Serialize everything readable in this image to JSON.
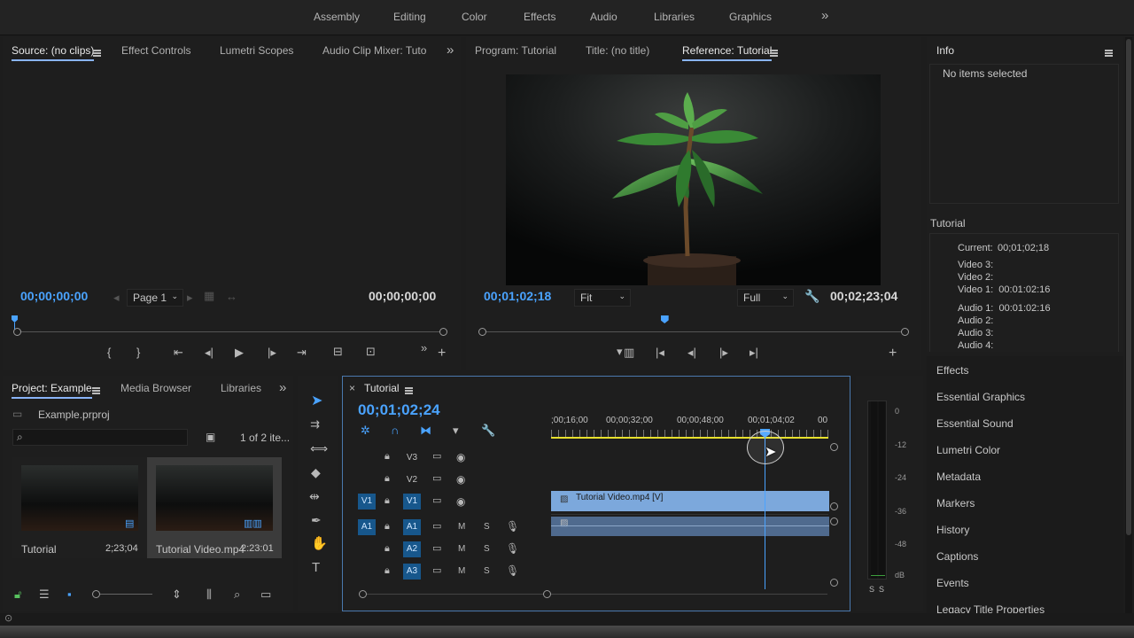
{
  "workspaces": [
    "Assembly",
    "Editing",
    "Color",
    "Effects",
    "Audio",
    "Libraries",
    "Graphics"
  ],
  "workspaces_more": "»",
  "source_panel": {
    "tabs": [
      "Source: (no clips)",
      "Effect Controls",
      "Lumetri Scopes",
      "Audio Clip Mixer: Tutoria"
    ],
    "timecode_in": "00;00;00;00",
    "timecode_out": "00;00;00;00",
    "page_select": "Page 1"
  },
  "program_panel": {
    "tabs": [
      "Program: Tutorial",
      "Title: (no title)",
      "Reference: Tutorial"
    ],
    "timecode": "00;01;02;18",
    "fit": "Fit",
    "quality": "Full",
    "duration": "00;02;23;04",
    "playhead_fraction": 0.43
  },
  "info_panel": {
    "title": "Info",
    "no_items": "No items selected",
    "sequence": "Tutorial",
    "current_label": "Current:",
    "current_value": "00;01;02;18",
    "video_lines": [
      "Video 3:",
      "Video 2:",
      "Video 1:  00:01:02:16"
    ],
    "audio_lines": [
      "Audio 1:  00:01:02:16",
      "Audio 2:",
      "Audio 3:",
      "Audio 4:"
    ]
  },
  "right_panels": [
    "Effects",
    "Essential Graphics",
    "Essential Sound",
    "Lumetri Color",
    "Metadata",
    "Markers",
    "History",
    "Captions",
    "Events",
    "Legacy Title Properties"
  ],
  "project_panel": {
    "tabs": [
      "Project: Example",
      "Media Browser",
      "Libraries"
    ],
    "project_file": "Example.prproj",
    "item_count": "1 of 2 ite...",
    "items": [
      {
        "name": "Tutorial",
        "duration": "2;23;04"
      },
      {
        "name": "Tutorial Video.mp4",
        "duration": "2:23:01"
      }
    ]
  },
  "timeline": {
    "tab": "Tutorial",
    "timecode": "00;01;02;24",
    "ruler": [
      ";00;16;00",
      "00;00;32;00",
      "00;00;48;00",
      "00;01;04;02",
      "00"
    ],
    "video_tracks": [
      {
        "label": "V3",
        "source": ""
      },
      {
        "label": "V2",
        "source": ""
      },
      {
        "label": "V1",
        "source": "V1"
      }
    ],
    "audio_tracks": [
      {
        "label": "A1",
        "source": "A1"
      },
      {
        "label": "A2",
        "source": ""
      },
      {
        "label": "A3",
        "source": ""
      }
    ],
    "clip_name": "Tutorial Video.mp4 [V]",
    "mute": "M",
    "solo": "S"
  },
  "meter": {
    "labels": [
      "0",
      "-12",
      "-24",
      "-36",
      "-48",
      "dB"
    ],
    "solo": [
      "S",
      "S"
    ]
  },
  "colors": {
    "accent": "#4aa3ff",
    "clip_video": "#7ca8dc",
    "clip_audio": "#4f6a8e",
    "track_btn": "#17578c",
    "playhead": "#4aa3ff"
  }
}
